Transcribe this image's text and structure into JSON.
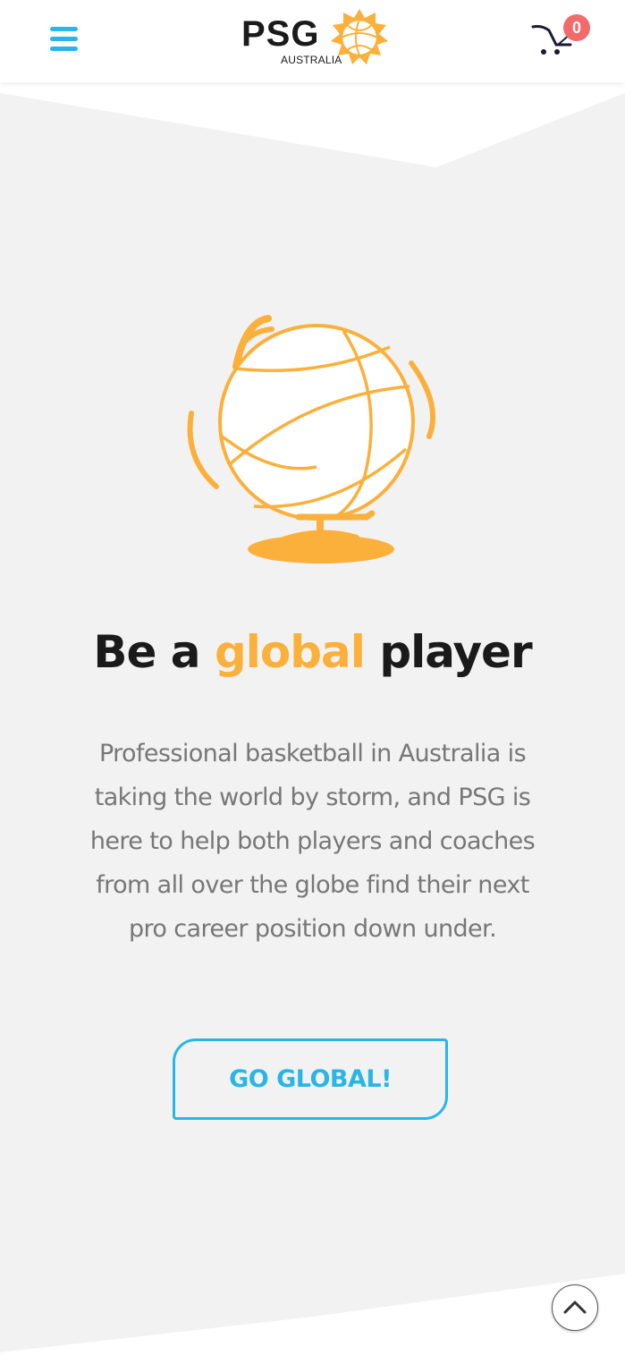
{
  "header": {
    "menu_icon": "hamburger-menu-icon",
    "logo": {
      "main_text": "PSG",
      "sub_text": "AUSTRALIA",
      "icon": "basketball-sun-icon"
    },
    "cart": {
      "icon": "shopping-cart-icon",
      "count": "0"
    }
  },
  "hero": {
    "icon": "basketball-globe-icon",
    "headline_before": "Be a ",
    "headline_accent": "global",
    "headline_after": " player",
    "body": "Professional basketball in Australia is taking the world by storm, and PSG is here to help both players and coaches from all over the globe find their next pro career position down under.",
    "cta_label": "GO GLOBAL!"
  },
  "scroll_top_icon": "chevron-up-icon",
  "colors": {
    "accent_blue": "#29b6e6",
    "accent_orange": "#fbb03b",
    "badge_red": "#f36a6a",
    "section_bg": "#f2f2f2",
    "text_dark": "#1a1a1a",
    "text_gray": "#777777"
  }
}
